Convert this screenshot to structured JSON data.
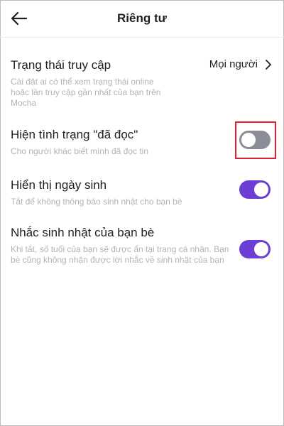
{
  "header": {
    "title": "Riêng tư",
    "back_icon": "arrow-left-icon"
  },
  "settings": [
    {
      "title": "Trạng thái truy cập",
      "description": "Cài đặt ai có thể xem trạng thái online hoặc lần truy cập gần nhất của bạn trên Mocha",
      "value": "Mọi người",
      "control": "chevron"
    },
    {
      "title": "Hiện tình trạng \"đã đọc\"",
      "description": "Cho người khác biết mình đã đọc tin",
      "control": "toggle",
      "enabled": false,
      "highlighted": true
    },
    {
      "title": "Hiển thị ngày sinh",
      "description": "Tắt để không thông báo sinh nhật cho bạn bè",
      "control": "toggle",
      "enabled": true
    },
    {
      "title": "Nhắc sinh nhật của bạn bè",
      "description": "Khi tắt, số tuổi của bạn sẽ được ẩn tại trang cá nhân. Bạn bè cũng không nhận được lời nhắc về sinh nhật của bạn",
      "control": "toggle",
      "enabled": true
    }
  ],
  "colors": {
    "toggle_on": "#6d3ed6",
    "toggle_off": "#8a8d96",
    "highlight": "#e0212e",
    "description_text": "#b3b3b3"
  }
}
